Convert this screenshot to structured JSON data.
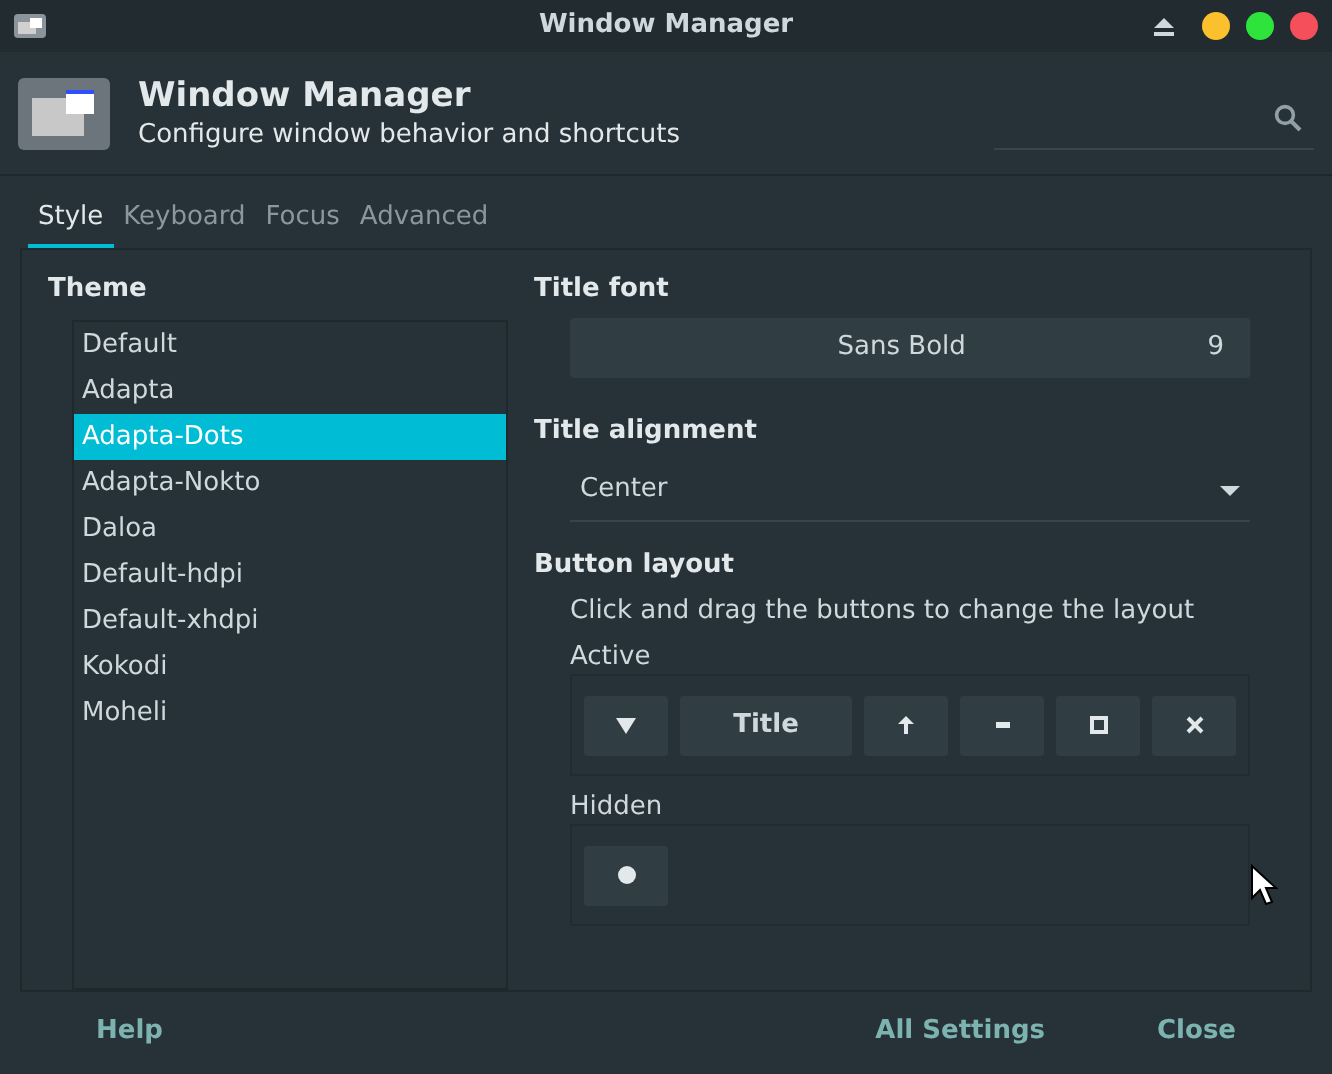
{
  "window": {
    "title": "Window Manager"
  },
  "header": {
    "title": "Window Manager",
    "subtitle": "Configure window behavior and shortcuts"
  },
  "tabs": [
    {
      "label": "Style",
      "selected": true
    },
    {
      "label": "Keyboard",
      "selected": false
    },
    {
      "label": "Focus",
      "selected": false
    },
    {
      "label": "Advanced",
      "selected": false
    }
  ],
  "theme": {
    "heading": "Theme",
    "items": [
      {
        "label": "Default",
        "selected": false
      },
      {
        "label": "Adapta",
        "selected": false
      },
      {
        "label": "Adapta-Dots",
        "selected": true
      },
      {
        "label": "Adapta-Nokto",
        "selected": false
      },
      {
        "label": "Daloa",
        "selected": false
      },
      {
        "label": "Default-hdpi",
        "selected": false
      },
      {
        "label": "Default-xhdpi",
        "selected": false
      },
      {
        "label": "Kokodi",
        "selected": false
      },
      {
        "label": "Moheli",
        "selected": false
      }
    ]
  },
  "title_font": {
    "heading": "Title font",
    "font": "Sans Bold",
    "size": "9"
  },
  "title_alignment": {
    "heading": "Title alignment",
    "value": "Center"
  },
  "button_layout": {
    "heading": "Button layout",
    "hint": "Click and drag the buttons to change the layout",
    "active_label": "Active",
    "active": [
      {
        "kind": "menu"
      },
      {
        "kind": "title",
        "label": "Title"
      },
      {
        "kind": "shade"
      },
      {
        "kind": "minimize"
      },
      {
        "kind": "maximize"
      },
      {
        "kind": "close"
      }
    ],
    "hidden_label": "Hidden",
    "hidden": [
      {
        "kind": "stick"
      }
    ]
  },
  "footer": {
    "help": "Help",
    "all_settings": "All Settings",
    "close": "Close"
  }
}
